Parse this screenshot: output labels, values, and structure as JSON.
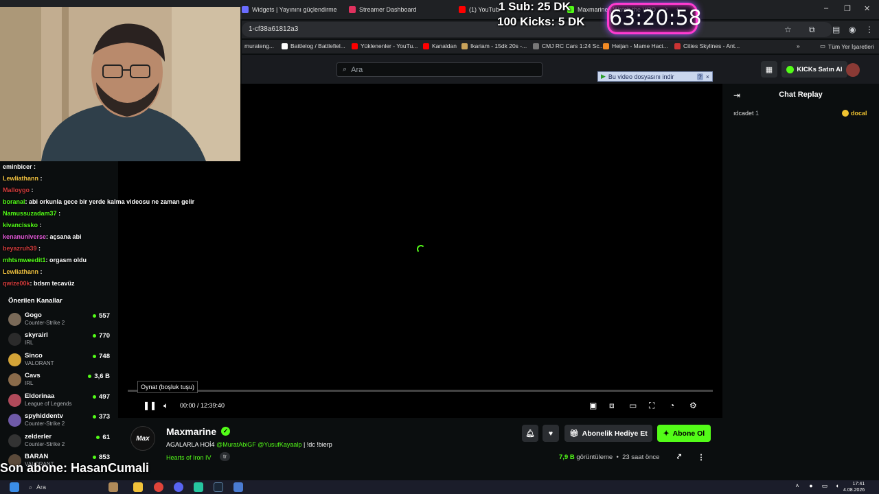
{
  "browser": {
    "tabs": [
      {
        "label": "Widgets | Yayınını güçlendirme",
        "color": "#6a6cff"
      },
      {
        "label": "Streamer Dashboard",
        "color": "#e0315e"
      },
      {
        "label": "(1) YouTube",
        "color": "#ff0000"
      },
      {
        "label": "Maxmarine | Watch the VOD",
        "color": "#53fc18"
      }
    ],
    "url": "1-cf38a61812a3",
    "bookmarks": [
      {
        "label": "murateng...",
        "color": "#888"
      },
      {
        "label": "Battlelog / Battlefiel...",
        "color": "#ffffff"
      },
      {
        "label": "Yüklenenler - YouTu...",
        "color": "#ff0000"
      },
      {
        "label": "Kanaldan",
        "color": "#ff0000"
      },
      {
        "label": "Ikariam - 15dk 20s -...",
        "color": "#c9a25a"
      },
      {
        "label": "CMJ RC Cars 1:24 Sc...",
        "color": "#777"
      },
      {
        "label": "Heijan - Mame Haci...",
        "color": "#f08a24"
      },
      {
        "label": "Cities Skylines - Ant...",
        "color": "#c33"
      }
    ],
    "all_bookmarks": "Tüm Yer İşaretleri",
    "bookmarks_more": "»"
  },
  "kick": {
    "search_placeholder": "Ara",
    "buy_kicks": "KICKs Satın Al",
    "download_bar": "Bu video dosyasını indir",
    "download_help": "?",
    "download_close": "×"
  },
  "player": {
    "tooltip": "Oynat (boşluk tuşu)",
    "time": "00:00 / 12:39:40",
    "progress": 0.0
  },
  "chat_replay": {
    "title": "Chat Replay",
    "row_name": "ıdcadet",
    "row_count": "1",
    "row_right": "docal"
  },
  "channel": {
    "logo_text": "Max",
    "name": "Maxmarine",
    "title_prefix": "AGALARLA HOİ4",
    "mention1": "@MuratAbiGF",
    "mention2": "@YusufKayaalp",
    "title_suffix": "| !dc !bierp",
    "category": "Hearts of Iron IV",
    "language": "tr",
    "gift_sub": "Abonelik Hediye Et",
    "subscribe": "Abone Ol",
    "views_num": "7,9 B",
    "views_label": "görüntüleme",
    "time_ago": "23 saat önce"
  },
  "overlay": {
    "goal_line1": "1 Sub: 25 DK",
    "goal_line2": "100 Kicks: 5 DK",
    "timer": "63:20:58",
    "last_sub": "Son abone: HasanCumali"
  },
  "overlay_chat": [
    {
      "user": "eminbicer",
      "msg": ":",
      "color": "#ffffff"
    },
    {
      "user": "Lewliathann",
      "msg": ":",
      "color": "#f4c542"
    },
    {
      "user": "Malloygo",
      "msg": ":",
      "color": "#d43c3c"
    },
    {
      "user": "boranal",
      "msg": ": abi orkunla gece bir yerde kalma videosu ne zaman gelir",
      "color": "#53fc18"
    },
    {
      "user": "Namussuzadam37",
      "msg": ":",
      "color": "#53fc18"
    },
    {
      "user": "kivancissko",
      "msg": ":",
      "color": "#53fc18"
    },
    {
      "user": "kenanuniverse",
      "msg": ": açsana abi",
      "color": "#e35ad9"
    },
    {
      "user": "beyazruh39",
      "msg": ":",
      "color": "#d43c3c"
    },
    {
      "user": "mhtsmweedit1",
      "msg": ": orgasm oldu",
      "color": "#53fc18"
    },
    {
      "user": "Lewliathann",
      "msg": ":",
      "color": "#f4c542"
    },
    {
      "user": "qwize00k",
      "msg": ": bdsm tecavüz",
      "color": "#d43c3c"
    }
  ],
  "recommended": {
    "title": "Önerilen Kanallar",
    "channels": [
      {
        "name": "Gogo",
        "game": "Counter-Strike 2",
        "viewers": "557",
        "color": "#7a6a58"
      },
      {
        "name": "skyrairl",
        "game": "IRL",
        "viewers": "770",
        "color": "#2b2b2b"
      },
      {
        "name": "Sinco",
        "game": "VALORANT",
        "viewers": "748",
        "color": "#d4a437"
      },
      {
        "name": "Cavs",
        "game": "IRL",
        "viewers": "3,6 B",
        "color": "#8a6b4a"
      },
      {
        "name": "Eldorinaa",
        "game": "League of Legends",
        "viewers": "497",
        "color": "#b04a5a"
      },
      {
        "name": "spyhiddentv",
        "game": "Counter-Strike 2",
        "viewers": "373",
        "color": "#6f5aa8"
      },
      {
        "name": "zelderler",
        "game": "Counter-Strike 2",
        "viewers": "61",
        "color": "#333"
      },
      {
        "name": "BARAN",
        "game": "VALORANT",
        "viewers": "853",
        "color": "#5b4a3a"
      }
    ]
  },
  "taskbar": {
    "search": "Ara",
    "time": "17:41",
    "date": "4.08.2026"
  }
}
